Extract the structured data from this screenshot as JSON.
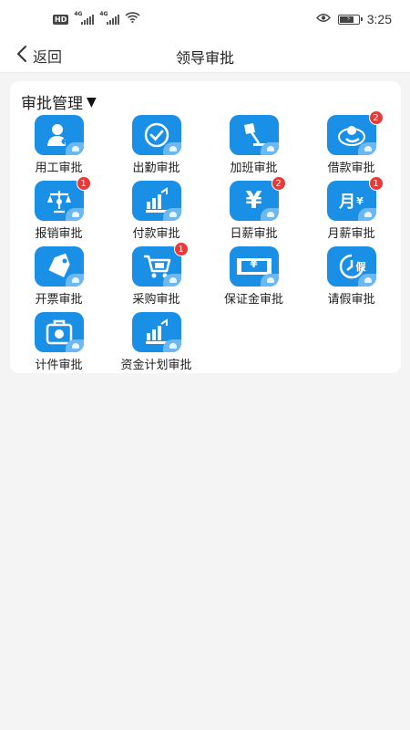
{
  "status_bar": {
    "hd_badge": "HD",
    "signal_tag_1": "4G",
    "signal_tag_2": "4G",
    "time": "3:25",
    "icons": [
      "wifi-icon",
      "eye-icon",
      "battery-icon"
    ]
  },
  "nav": {
    "back_label": "返回",
    "title": "领导审批"
  },
  "section": {
    "title": "审批管理",
    "caret": "▼"
  },
  "items": [
    {
      "label": "用工审批",
      "icon": "employment-icon",
      "badge": ""
    },
    {
      "label": "出勤审批",
      "icon": "attendance-icon",
      "badge": ""
    },
    {
      "label": "加班审批",
      "icon": "overtime-lamp-icon",
      "badge": ""
    },
    {
      "label": "借款审批",
      "icon": "loan-icon",
      "badge": "2"
    },
    {
      "label": "报销审批",
      "icon": "reimbursement-scale-icon",
      "badge": "1"
    },
    {
      "label": "付款审批",
      "icon": "payment-icon",
      "badge": ""
    },
    {
      "label": "日薪审批",
      "icon": "daily-salary-yen-icon",
      "badge": "2"
    },
    {
      "label": "月薪审批",
      "icon": "monthly-salary-icon",
      "badge": "1"
    },
    {
      "label": "开票审批",
      "icon": "invoice-tag-icon",
      "badge": ""
    },
    {
      "label": "采购审批",
      "icon": "shopping-cart-icon",
      "badge": "1"
    },
    {
      "label": "保证金审批",
      "icon": "deposit-banknote-icon",
      "badge": ""
    },
    {
      "label": "请假审批",
      "icon": "leave-clock-icon",
      "badge": ""
    },
    {
      "label": "计件审批",
      "icon": "piecework-box-icon",
      "badge": ""
    },
    {
      "label": "资金计划审批",
      "icon": "fund-plan-icon",
      "badge": ""
    }
  ],
  "glyphs": {
    "yen": "¥",
    "month": "月",
    "leave": "假"
  },
  "colors": {
    "tile_blue": "#1a8fe6",
    "badge_red": "#e93a3a",
    "background": "#f4f4f5"
  }
}
